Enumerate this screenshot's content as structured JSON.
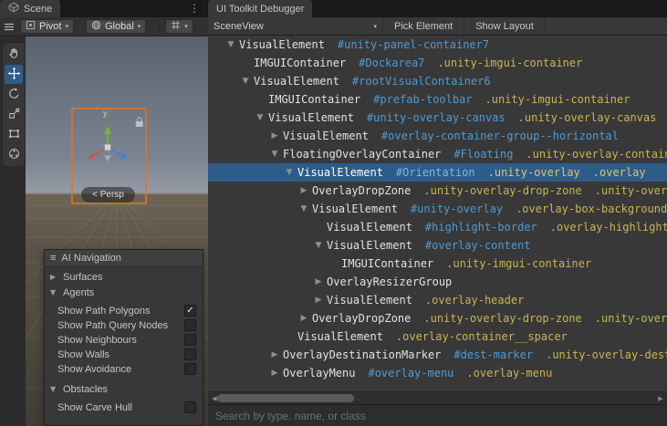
{
  "colors": {
    "selection_blue": "#2d5c8a",
    "id_blue": "#4f9bd5",
    "class_yellow": "#c8b655",
    "overlay_highlight_orange": "#e8731a"
  },
  "scene_panel": {
    "tab_label": "Scene",
    "toolbar": {
      "pivot_label": "Pivot",
      "global_label": "Global"
    },
    "tools": [
      {
        "name": "view-tool",
        "icon": "hand",
        "selected": false
      },
      {
        "name": "move-tool",
        "icon": "move",
        "selected": true
      },
      {
        "name": "rotate-tool",
        "icon": "rotate",
        "selected": false
      },
      {
        "name": "scale-tool",
        "icon": "scale",
        "selected": false
      },
      {
        "name": "rect-tool",
        "icon": "rect",
        "selected": false
      },
      {
        "name": "custom-tools",
        "icon": "custom",
        "selected": false
      }
    ],
    "viewport": {
      "axis_label": "y",
      "persp_label": "< Persp"
    },
    "nav_overlay": {
      "title": "AI Navigation",
      "sections": [
        {
          "label": "Surfaces",
          "expanded": false,
          "items": []
        },
        {
          "label": "Agents",
          "expanded": true,
          "items": [
            {
              "label": "Show Path Polygons",
              "checked": true
            },
            {
              "label": "Show Path Query Nodes",
              "checked": false
            },
            {
              "label": "Show Neighbours",
              "checked": false
            },
            {
              "label": "Show Walls",
              "checked": false
            },
            {
              "label": "Show Avoidance",
              "checked": false
            }
          ]
        },
        {
          "label": "Obstacles",
          "expanded": true,
          "items": [
            {
              "label": "Show Carve Hull",
              "checked": false
            }
          ]
        }
      ]
    }
  },
  "debugger_panel": {
    "tab_label": "UI Toolkit Debugger",
    "toolbar": {
      "target_selector": "SceneView",
      "pick_element_label": "Pick Element",
      "show_layout_label": "Show Layout"
    },
    "search_placeholder": "Search by type, name, or class",
    "tree": [
      {
        "level": 0,
        "state": "expanded",
        "name": "VisualElement",
        "id": "#unity-panel-container7",
        "classes": []
      },
      {
        "level": 1,
        "state": "leaf",
        "name": "IMGUIContainer",
        "id": "#Dockarea7",
        "classes": [
          ".unity-imgui-container"
        ]
      },
      {
        "level": 1,
        "state": "expanded",
        "name": "VisualElement",
        "id": "#rootVisualContainer6",
        "classes": []
      },
      {
        "level": 2,
        "state": "leaf",
        "name": "IMGUIContainer",
        "id": "#prefab-toolbar",
        "classes": [
          ".unity-imgui-container"
        ]
      },
      {
        "level": 2,
        "state": "expanded",
        "name": "VisualElement",
        "id": "#unity-overlay-canvas",
        "classes": [
          ".unity-overlay-canvas"
        ]
      },
      {
        "level": 3,
        "state": "collapsed",
        "name": "VisualElement",
        "id": "#overlay-container-group--horizontal",
        "classes": []
      },
      {
        "level": 3,
        "state": "expanded",
        "name": "FloatingOverlayContainer",
        "id": "#Floating",
        "classes": [
          ".unity-overlay-container"
        ]
      },
      {
        "level": 4,
        "state": "expanded",
        "name": "VisualElement",
        "id": "#Orientation",
        "classes": [
          ".unity-overlay",
          ".overlay"
        ],
        "selected": true
      },
      {
        "level": 5,
        "state": "collapsed",
        "name": "OverlayDropZone",
        "id": "",
        "classes": [
          ".unity-overlay-drop-zone",
          ".unity-overlay-drop-zone--start"
        ]
      },
      {
        "level": 5,
        "state": "expanded",
        "name": "VisualElement",
        "id": "#unity-overlay",
        "classes": [
          ".overlay-box-background"
        ]
      },
      {
        "level": 6,
        "state": "leaf",
        "name": "VisualElement",
        "id": "#highlight-border",
        "classes": [
          ".overlay-highlight"
        ]
      },
      {
        "level": 6,
        "state": "expanded",
        "name": "VisualElement",
        "id": "#overlay-content",
        "classes": []
      },
      {
        "level": 7,
        "state": "leaf",
        "name": "IMGUIContainer",
        "id": "",
        "classes": [
          ".unity-imgui-container"
        ]
      },
      {
        "level": 6,
        "state": "collapsed",
        "name": "OverlayResizerGroup",
        "id": "",
        "classes": []
      },
      {
        "level": 6,
        "state": "collapsed",
        "name": "VisualElement",
        "id": "",
        "classes": [
          ".overlay-header"
        ]
      },
      {
        "level": 5,
        "state": "collapsed",
        "name": "OverlayDropZone",
        "id": "",
        "classes": [
          ".unity-overlay-drop-zone",
          ".unity-overlay-drop-zone--end"
        ]
      },
      {
        "level": 4,
        "state": "leaf",
        "name": "VisualElement",
        "id": "",
        "classes": [
          ".overlay-container__spacer"
        ]
      },
      {
        "level": 3,
        "state": "collapsed",
        "name": "OverlayDestinationMarker",
        "id": "#dest-marker",
        "classes": [
          ".unity-overlay-destination-marker"
        ]
      },
      {
        "level": 3,
        "state": "collapsed",
        "name": "OverlayMenu",
        "id": "#overlay-menu",
        "classes": [
          ".overlay-menu"
        ]
      }
    ]
  }
}
